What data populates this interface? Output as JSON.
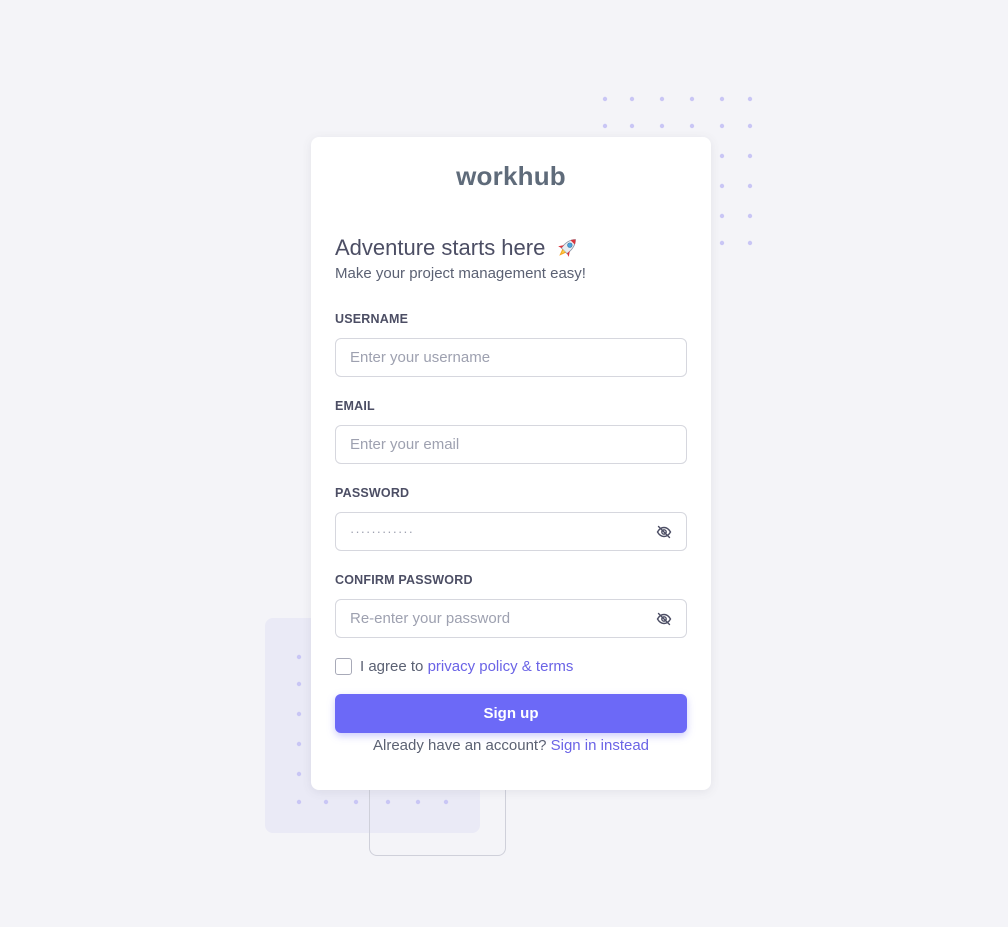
{
  "brand": {
    "name": "workhub"
  },
  "header": {
    "title": "Adventure starts here",
    "subtitle": "Make your project management easy!"
  },
  "form": {
    "username": {
      "label": "USERNAME",
      "placeholder": "Enter your username",
      "value": ""
    },
    "email": {
      "label": "EMAIL",
      "placeholder": "Enter your email",
      "value": ""
    },
    "password": {
      "label": "PASSWORD",
      "masked_value": "············"
    },
    "confirm_password": {
      "label": "CONFIRM PASSWORD",
      "placeholder": "Re-enter your password",
      "value": ""
    },
    "agree": {
      "prefix": "I agree to",
      "link": "privacy policy & terms",
      "checked": false
    },
    "submit_label": "Sign up"
  },
  "footer": {
    "prompt": "Already have an account?",
    "link": "Sign in instead"
  },
  "icons": {
    "heading": "rocket-icon",
    "password_toggle": "eye-off-icon",
    "confirm_toggle": "eye-off-icon"
  },
  "colors": {
    "primary": "#6c69f7",
    "link": "#6a63e6",
    "background": "#f4f4f8",
    "card": "#ffffff",
    "text": "#4c4e64",
    "dots": "#c9c6f5"
  }
}
